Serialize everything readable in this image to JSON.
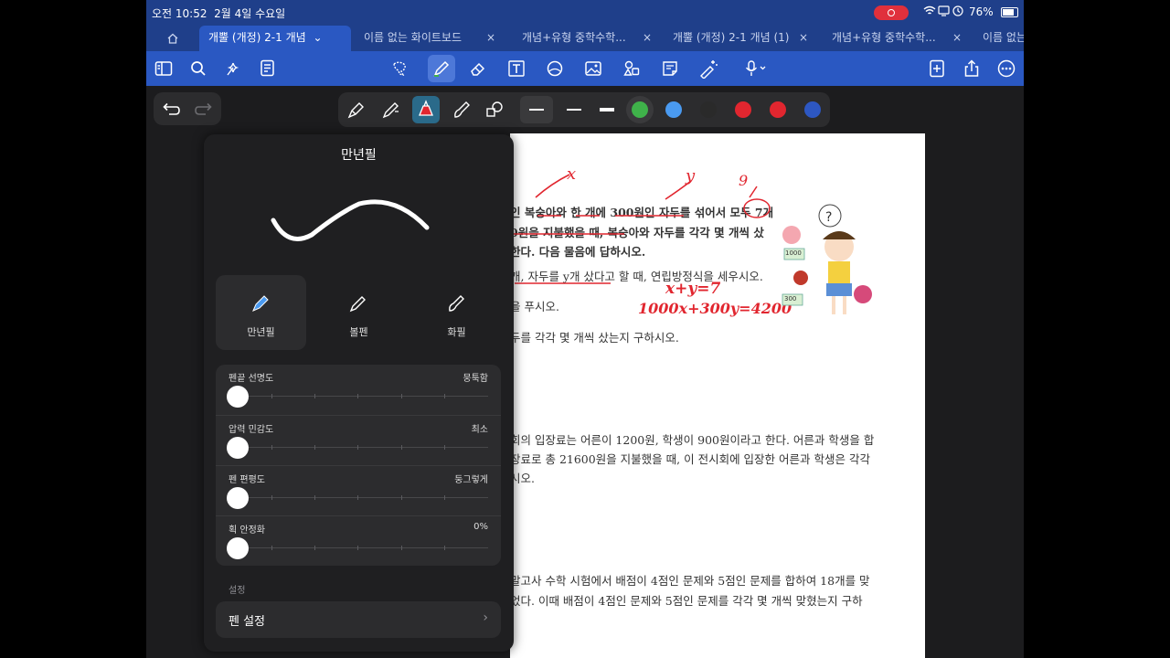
{
  "status": {
    "time": "오전 10:52",
    "date": "2월 4일 수요일",
    "battery": "76%"
  },
  "tabs": [
    {
      "label": "개뿔 (개정) 2-1 개념",
      "active": true
    },
    {
      "label": "이름 없는 화이트보드",
      "active": false
    },
    {
      "label": "개념+유형 중학수학...",
      "active": false
    },
    {
      "label": "개뿔 (개정) 2-1 개념 (1)",
      "active": false
    },
    {
      "label": "개념+유형 중학수학...",
      "active": false
    },
    {
      "label": "이름 없는",
      "active": false
    }
  ],
  "tab_close": "×",
  "tab_dropdown": "⌄",
  "toolbar": {
    "left": [
      "sidebar-icon",
      "search-icon",
      "sparkle-icon",
      "document-icon"
    ],
    "center": [
      "lasso-icon",
      "pen-icon",
      "eraser-icon",
      "text-icon",
      "shape-icon",
      "image-icon",
      "sticker-icon",
      "note-icon",
      "laser-icon",
      "mic-icon"
    ],
    "right": [
      "add-page-icon",
      "share-icon",
      "more-icon"
    ]
  },
  "colors": [
    "#3fb24a",
    "#4a9af0",
    "#2a2a2a",
    "#e1262f",
    "#e1262f",
    "#2d57c2"
  ],
  "document": {
    "lines": [
      "인 복숭아와 한 개에 300원인 자두를 섞어서 모두 7개",
      "0원을 지불했을 때, 복숭아와 자두를 각각 몇 개씩 샀",
      "한다. 다음 물음에 답하시오.",
      "개, 자두를 y개 샀다고 할 때, 연립방정식을 세우시오.",
      "을 푸시오.",
      "두를 각각 몇 개씩 샀는지 구하시오.",
      "회의 입장료는 어른이 1200원, 학생이 900원이라고 한다. 어른과 학생을 합",
      "장료로 총 21600원을 지불했을 때, 이 전시회에 입장한 어른과 학생은 각각",
      "시오.",
      "말고사 수학 시험에서 배점이 4점인 문제와 5점인 문제를 합하여 18개를 맞",
      "었다. 이때 배점이 4점인 문제와 5점인 문제를 각각 몇 개씩 맞혔는지 구하"
    ],
    "handwriting": {
      "x": "x",
      "y": "y",
      "nine": "9",
      "eq1": "x+y=7",
      "eq2": "1000x+300y=4200"
    },
    "stickers": [
      "1000",
      "300"
    ]
  },
  "popup": {
    "title": "만년필",
    "pens": [
      "만년필",
      "볼펜",
      "화필"
    ],
    "sliders": [
      {
        "name": "펜끝 선명도",
        "value": "뭉툭함",
        "level": 0
      },
      {
        "name": "압력 민감도",
        "value": "최소",
        "level": 0
      },
      {
        "name": "펜 편평도",
        "value": "둥그렇게",
        "level": 0
      },
      {
        "name": "획 안정화",
        "value": "0%",
        "level": 0
      }
    ],
    "section": "설정",
    "settings_row": "펜 설정",
    "settings_chevron": "›"
  }
}
